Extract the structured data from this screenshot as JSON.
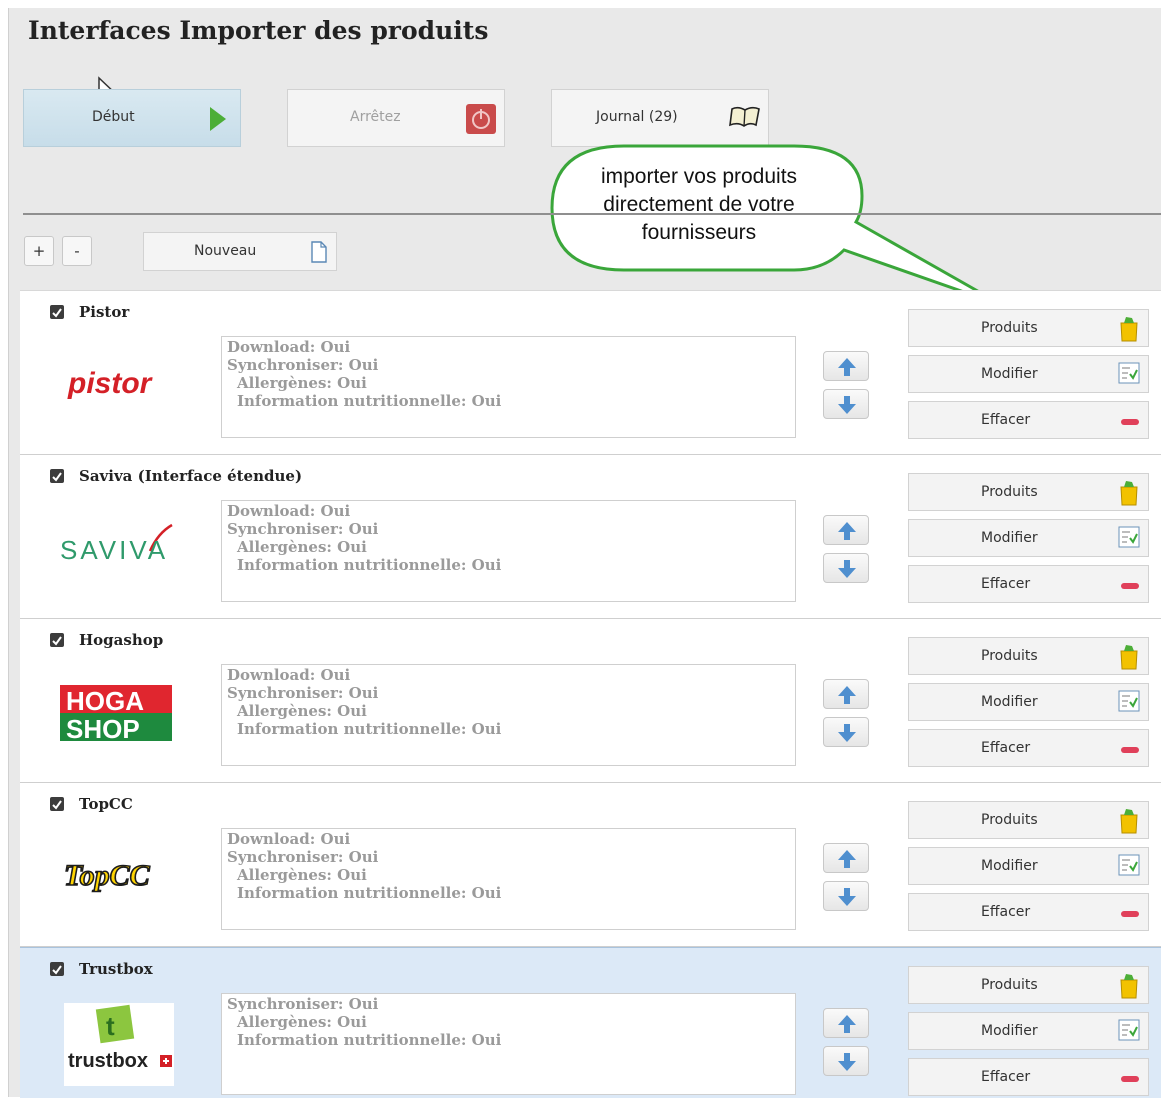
{
  "header": {
    "title": "Interfaces Importer des produits"
  },
  "toolbar": {
    "start_label": "Début",
    "stop_label": "Arrêtez",
    "journal_label": "Journal (29)"
  },
  "actions": {
    "plus": "+",
    "minus": "-",
    "new_label": "Nouveau"
  },
  "callout": {
    "line1": "importer vos produits",
    "line2": "directement de votre",
    "line3": "fournisseurs"
  },
  "interfaces": [
    {
      "name": "Pistor",
      "checked": true,
      "logo": "pistor-logo",
      "logo_text": "pistor",
      "lines": [
        "Download: Oui",
        "Synchroniser: Oui",
        "Allergènes: Oui",
        "Information nutritionnelle: Oui"
      ],
      "buttons": {
        "products": "Produits",
        "edit": "Modifier",
        "delete": "Effacer"
      }
    },
    {
      "name": "Saviva (Interface étendue)",
      "checked": true,
      "logo": "saviva-logo",
      "logo_text": "SAVIVA",
      "lines": [
        "Download: Oui",
        "Synchroniser: Oui",
        "Allergènes: Oui",
        "Information nutritionnelle: Oui"
      ],
      "buttons": {
        "products": "Produits",
        "edit": "Modifier",
        "delete": "Effacer"
      }
    },
    {
      "name": "Hogashop",
      "checked": true,
      "logo": "hogashop-logo",
      "logo_text": "HOGA SHOP",
      "lines": [
        "Download: Oui",
        "Synchroniser: Oui",
        "Allergènes: Oui",
        "Information nutritionnelle: Oui"
      ],
      "buttons": {
        "products": "Produits",
        "edit": "Modifier",
        "delete": "Effacer"
      }
    },
    {
      "name": "TopCC",
      "checked": true,
      "logo": "topcc-logo",
      "logo_text": "TopCC",
      "lines": [
        "Download: Oui",
        "Synchroniser: Oui",
        "Allergènes: Oui",
        "Information nutritionnelle: Oui"
      ],
      "buttons": {
        "products": "Produits",
        "edit": "Modifier",
        "delete": "Effacer"
      }
    },
    {
      "name": "Trustbox",
      "checked": true,
      "selected": true,
      "logo": "trustbox-logo",
      "logo_text": "trustbox",
      "lines": [
        "Synchroniser: Oui",
        "Allergènes: Oui",
        "Information nutritionnelle: Oui"
      ],
      "buttons": {
        "products": "Produits",
        "edit": "Modifier",
        "delete": "Effacer"
      }
    }
  ],
  "colors": {
    "start_button": "#c7dde9",
    "callout_border": "#3aa63a",
    "selected_row": "#dce9f7"
  }
}
